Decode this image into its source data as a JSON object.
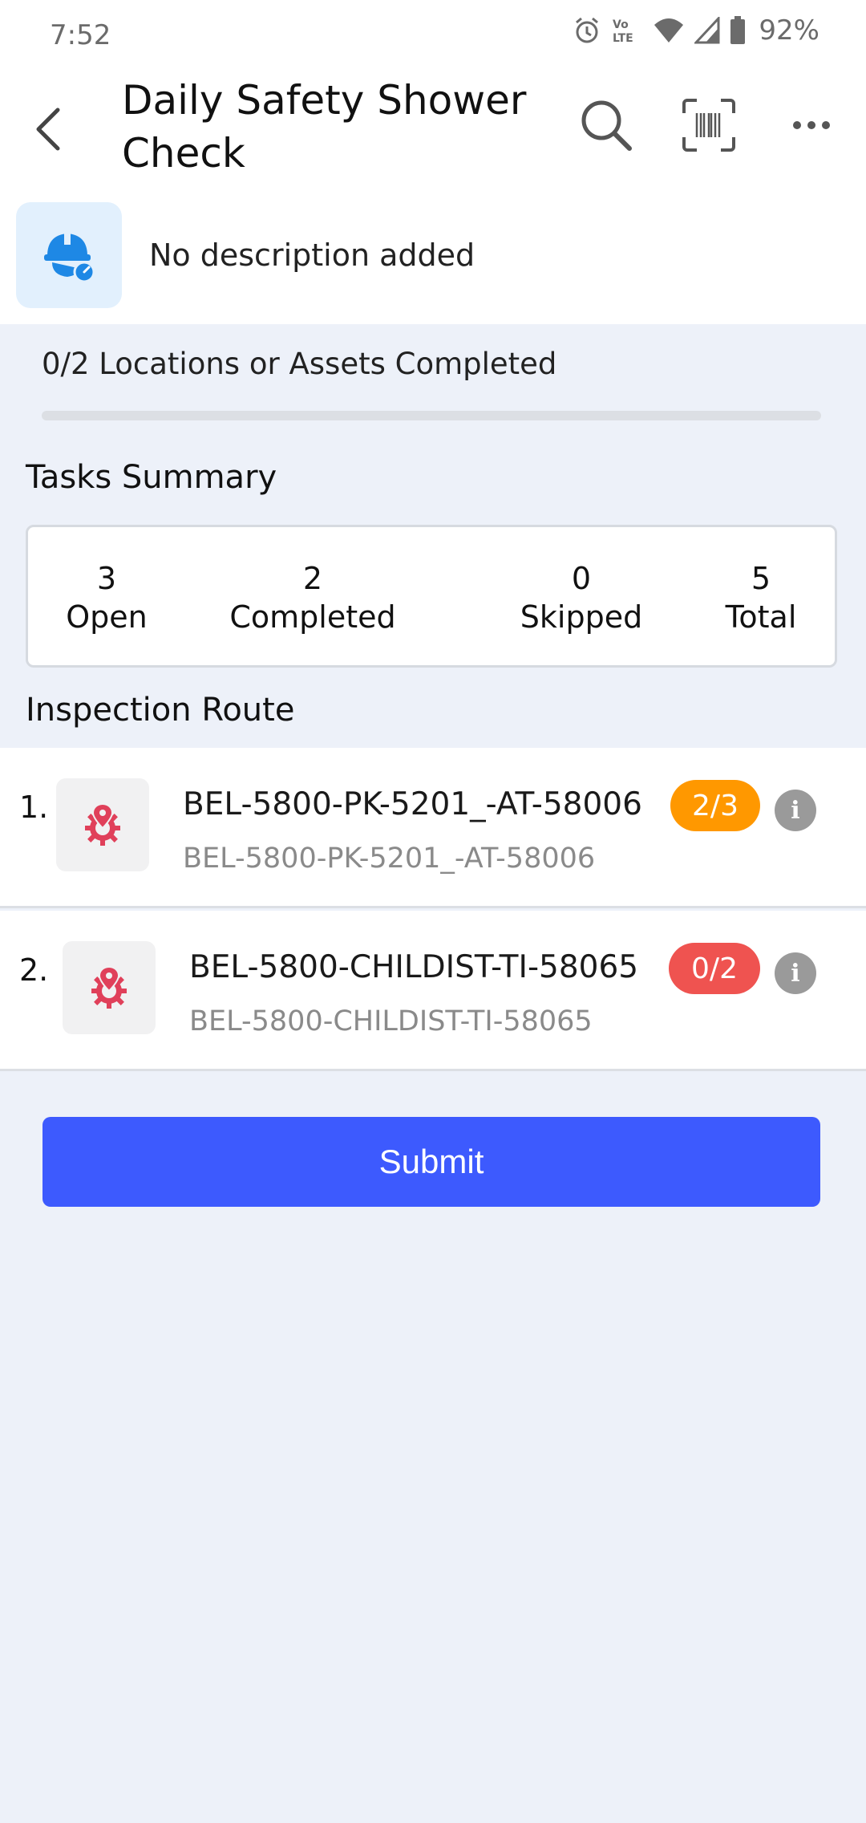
{
  "status_bar": {
    "time": "7:52",
    "icons": [
      "alarm-icon",
      "volte-icon",
      "wifi-icon",
      "signal-icon",
      "battery-icon"
    ],
    "volte_label": "Vo LTE",
    "battery": "92%"
  },
  "header": {
    "title": "Daily Safety Shower Check",
    "icons": [
      "back-arrow-icon",
      "search-icon",
      "barcode-scan-icon",
      "more-horizontal-icon"
    ]
  },
  "description": {
    "icon": "safety-helmet-icon",
    "text": "No description added"
  },
  "progress": {
    "label": "0/2 Locations or Assets Completed",
    "completed": 0,
    "total": 2
  },
  "tasks_summary": {
    "title": "Tasks Summary",
    "stats": [
      {
        "value": "3",
        "label": "Open"
      },
      {
        "value": "2",
        "label": "Completed"
      },
      {
        "value": "0",
        "label": "Skipped"
      },
      {
        "value": "5",
        "label": "Total"
      }
    ]
  },
  "inspection_route": {
    "title": "Inspection Route",
    "items": [
      {
        "index": "1.",
        "icon": "asset-location-icon",
        "name": "BEL-5800-PK-5201_-AT-58006",
        "subtitle": "BEL-5800-PK-5201_-AT-58006",
        "badge": "2/3",
        "badge_color": "#ff9800"
      },
      {
        "index": "2.",
        "icon": "asset-location-icon",
        "name": "BEL-5800-CHILDIST-TI-58065",
        "subtitle": "BEL-5800-CHILDIST-TI-58065",
        "badge": "0/2",
        "badge_color": "#ef5350"
      }
    ]
  },
  "submit": {
    "label": "Submit"
  },
  "colors": {
    "accent": "#3d5afe",
    "background": "#edf1f9",
    "icon_red": "#e0405a",
    "helmet_blue": "#1e88e5"
  }
}
